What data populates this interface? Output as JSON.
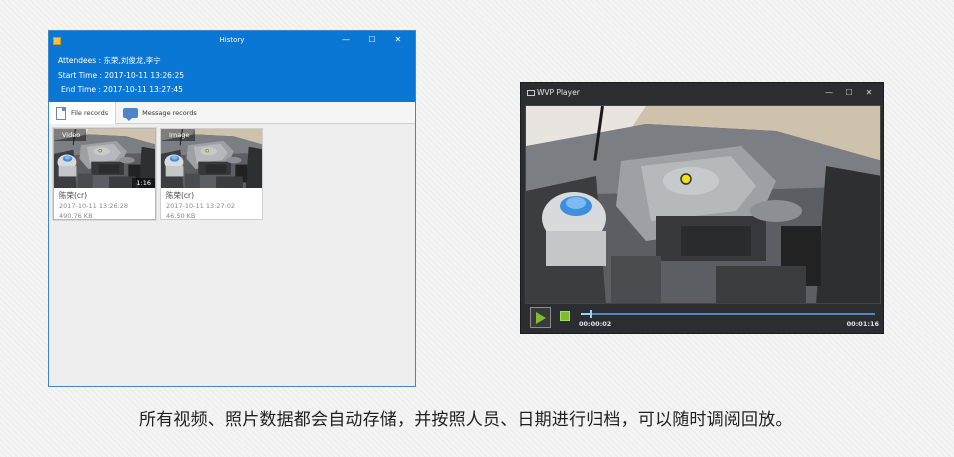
{
  "history_window": {
    "title": "History",
    "attendees_label": "Attendees : ",
    "attendees_value": "东荣,刘俊龙,李宁",
    "start_label": "Start Time : ",
    "start_value": "2017-10-11 13:26:25",
    "end_label": "End Time : ",
    "end_value": "2017-10-11 13:27:45",
    "tabs": [
      {
        "label": "File records",
        "icon": "file-icon"
      },
      {
        "label": "Message records",
        "icon": "message-icon"
      }
    ],
    "cards": [
      {
        "tag": "Video",
        "duration": "1:16",
        "name": "陈荣(cr)",
        "date": "2017-10-11 13:26:28",
        "size": "490.76 KB"
      },
      {
        "tag": "Image",
        "duration": "",
        "name": "陈荣(cr)",
        "date": "2017-10-11 13:27:02",
        "size": "46.50 KB"
      }
    ]
  },
  "player": {
    "title": "WVP Player",
    "current_time": "00:00:02",
    "total_time": "00:01:16",
    "progress": 0.03
  },
  "caption": "所有视频、照片数据都会自动存储，并按照人员、日期进行归档，可以随时调阅回放。"
}
